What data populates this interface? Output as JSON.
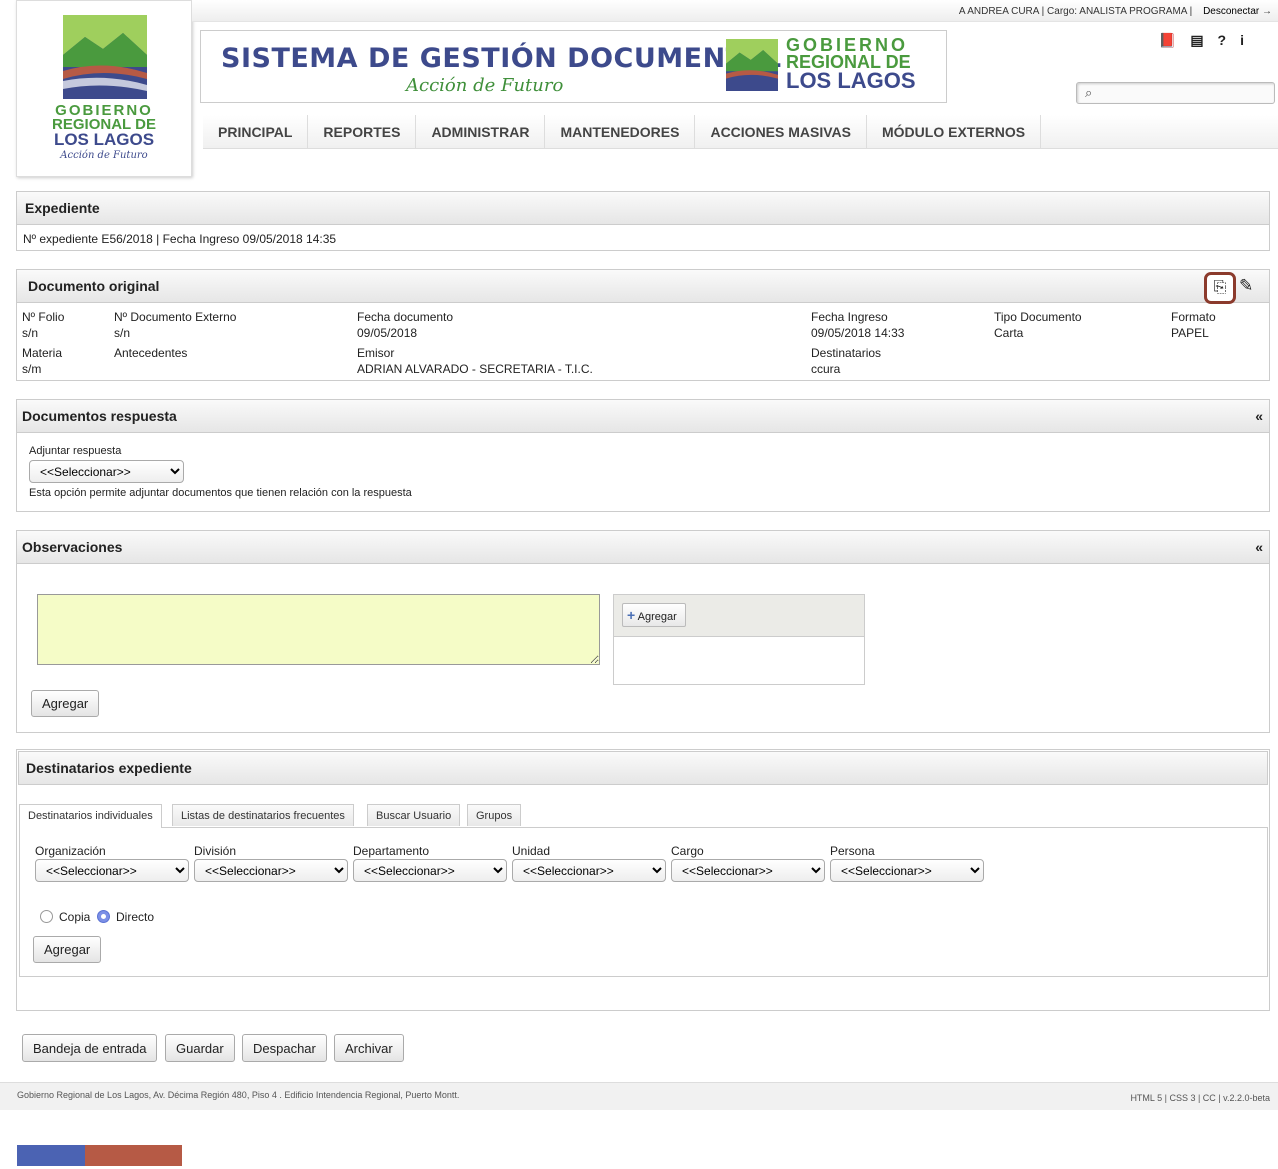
{
  "header": {
    "user_info": "A ANDREA CURA | Cargo: ANALISTA PROGRAMA |",
    "logout": "Desconectar",
    "banner_title": "SISTEMA DE GESTIÓN DOCUMENTAL",
    "banner_subtitle": "Acción de Futuro",
    "gob_line1": "GOBIERNO",
    "gob_line2": "REGIONAL DE",
    "gob_line3": "LOS LAGOS",
    "logo_slogan": "Acción de Futuro",
    "icons": [
      "book-icon",
      "newspaper-icon",
      "help-icon",
      "info-icon"
    ],
    "search_placeholder": ""
  },
  "nav": [
    "PRINCIPAL",
    "REPORTES",
    "ADMINISTRAR",
    "MANTENEDORES",
    "ACCIONES MASIVAS",
    "MÓDULO EXTERNOS"
  ],
  "expediente": {
    "title": "Expediente",
    "info": "Nº expediente  E56/2018  |  Fecha Ingreso 09/05/2018 14:35"
  },
  "documento": {
    "title": "Documento original",
    "fields": [
      {
        "label": "Nº Folio",
        "value": "s/n"
      },
      {
        "label": "Nº Documento Externo",
        "value": "s/n"
      },
      {
        "label": "Fecha documento",
        "value": "09/05/2018"
      },
      {
        "label": "Fecha Ingreso",
        "value": "09/05/2018 14:33"
      },
      {
        "label": "Tipo Documento",
        "value": "Carta"
      },
      {
        "label": "Formato",
        "value": "PAPEL"
      },
      {
        "label": "Materia",
        "value": "s/m"
      },
      {
        "label": "Antecedentes",
        "value": ""
      },
      {
        "label": "Emisor",
        "value": "ADRIAN ALVARADO - SECRETARIA - T.I.C."
      },
      {
        "label": "Destinatarios",
        "value": "ccura"
      }
    ]
  },
  "respuesta": {
    "title": "Documentos respuesta",
    "collapse": "«",
    "adjuntar_label": "Adjuntar respuesta",
    "select_value": "<<Seleccionar>>",
    "help": "Esta opción permite adjuntar documentos que tienen relación con la respuesta"
  },
  "observaciones": {
    "title": "Observaciones",
    "collapse": "«",
    "agregar_small": "Agregar",
    "agregar": "Agregar"
  },
  "destinatarios": {
    "title": "Destinatarios expediente",
    "tabs": [
      "Destinatarios individuales",
      "Listas de destinatarios frecuentes",
      "Buscar Usuario",
      "Grupos"
    ],
    "fields": [
      {
        "label": "Organización",
        "value": "<<Seleccionar>>"
      },
      {
        "label": "División",
        "value": "<<Seleccionar>>"
      },
      {
        "label": "Departamento",
        "value": "<<Seleccionar>>"
      },
      {
        "label": "Unidad",
        "value": "<<Seleccionar>>"
      },
      {
        "label": "Cargo",
        "value": "<<Seleccionar>>"
      },
      {
        "label": "Persona",
        "value": "<<Seleccionar>>"
      }
    ],
    "radio_copia": "Copia",
    "radio_directo": "Directo",
    "agregar": "Agregar"
  },
  "actions": [
    "Bandeja de entrada",
    "Guardar",
    "Despachar",
    "Archivar"
  ],
  "footer": {
    "address": "Gobierno Regional de Los Lagos, Av. Décima Región 480, Piso 4 . Edificio Intendencia Regional, Puerto Montt.",
    "version": "HTML 5 | CSS 3 | CC | v.2.2.0-beta"
  },
  "colors": {
    "brand_blue": "#3d4a8c",
    "brand_green": "#3f8f3a",
    "flag_blue": "#4b63b3",
    "flag_red": "#b65a45",
    "textarea_bg": "#f5fcc7"
  }
}
